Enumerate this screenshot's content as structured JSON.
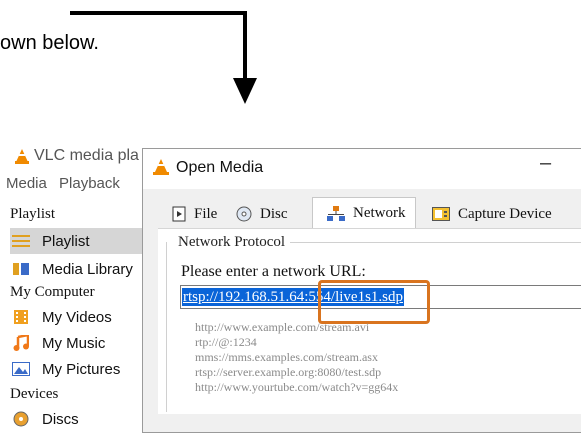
{
  "instruction": {
    "text": "own below."
  },
  "vlc": {
    "title": "VLC media pla",
    "menu": [
      "Media",
      "Playback"
    ],
    "sidebar": {
      "sections": [
        {
          "title": "Playlist",
          "items": [
            {
              "label": "Playlist",
              "icon": "playlist-icon",
              "selected": true
            },
            {
              "label": "Media Library",
              "icon": "media-library-icon"
            }
          ]
        },
        {
          "title": "My Computer",
          "items": [
            {
              "label": "My Videos",
              "icon": "videos-icon"
            },
            {
              "label": "My Music",
              "icon": "music-icon"
            },
            {
              "label": "My Pictures",
              "icon": "pictures-icon"
            }
          ]
        },
        {
          "title": "Devices",
          "items": [
            {
              "label": "Discs",
              "icon": "disc-icon"
            }
          ]
        }
      ]
    }
  },
  "dialog": {
    "title": "Open Media",
    "minimize_glyph": "–",
    "tabs": [
      {
        "label": "File",
        "icon": "file-icon"
      },
      {
        "label": "Disc",
        "icon": "disc-icon"
      },
      {
        "label": "Network",
        "icon": "network-icon",
        "active": true
      },
      {
        "label": "Capture Device",
        "icon": "capture-device-icon"
      }
    ],
    "group_title": "Network Protocol",
    "url_label": "Please enter a network URL:",
    "url_value": "rtsp://192.168.51.64:554/live1s1.sdp",
    "examples": [
      "http://www.example.com/stream.avi",
      "rtp://@:1234",
      "mms://mms.examples.com/stream.asx",
      "rtsp://server.example.org:8080/test.sdp",
      "http://www.yourtube.com/watch?v=gg64x"
    ]
  },
  "colors": {
    "highlight_box": "#d9741f",
    "selection": "#0a64d8",
    "vlc_orange": "#f08a00"
  }
}
